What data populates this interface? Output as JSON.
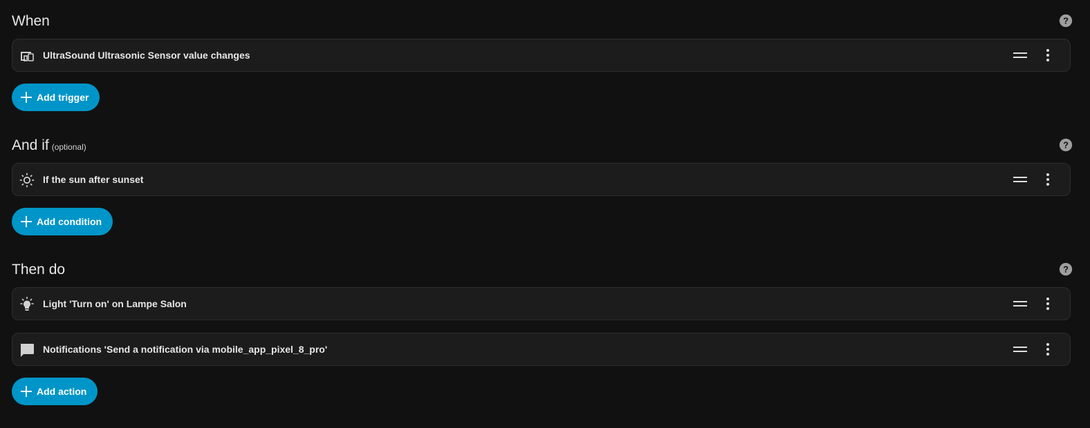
{
  "triggers": {
    "title": "When",
    "items": [
      {
        "label": "UltraSound Ultrasonic Sensor value changes",
        "icon": "devices-icon"
      }
    ],
    "add_label": "Add trigger"
  },
  "conditions": {
    "title": "And if",
    "optional": "(optional)",
    "items": [
      {
        "label": "If the sun after sunset",
        "icon": "sun-icon"
      }
    ],
    "add_label": "Add condition"
  },
  "actions": {
    "title": "Then do",
    "items": [
      {
        "label": "Light 'Turn on' on Lampe Salon",
        "icon": "lightbulb-icon"
      },
      {
        "label": "Notifications 'Send a notification via mobile_app_pixel_8_pro'",
        "icon": "message-icon"
      }
    ],
    "add_label": "Add action"
  },
  "colors": {
    "background": "#111111",
    "card": "#1c1c1c",
    "accent": "#0095c8"
  }
}
